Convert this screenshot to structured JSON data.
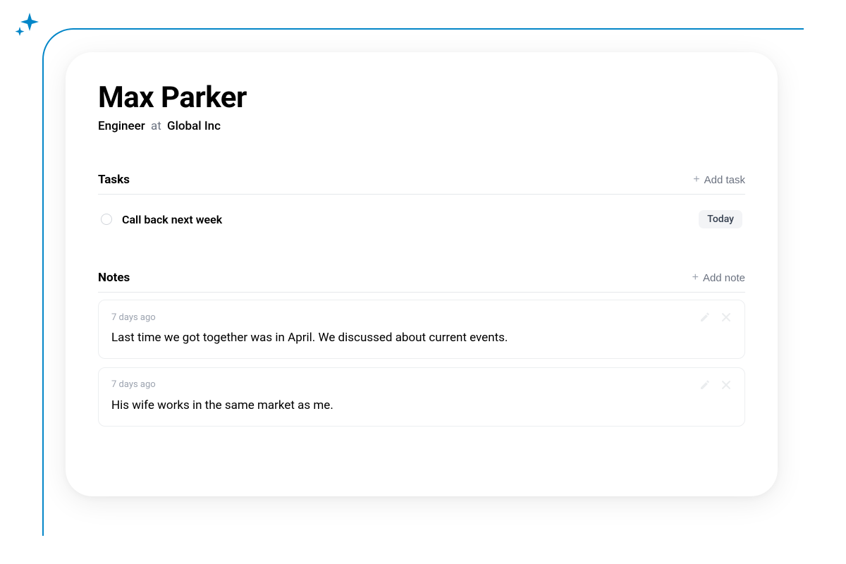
{
  "colors": {
    "accent_blue": "#0386c8"
  },
  "contact": {
    "name": "Max Parker",
    "role": "Engineer",
    "separator": "at",
    "company": "Global Inc"
  },
  "tasks": {
    "heading": "Tasks",
    "add_label": "Add task",
    "items": [
      {
        "text": "Call back next week",
        "due": "Today"
      }
    ]
  },
  "notes": {
    "heading": "Notes",
    "add_label": "Add note",
    "items": [
      {
        "time": "7 days ago",
        "body": "Last time we got together was in April. We discussed about current events."
      },
      {
        "time": "7 days ago",
        "body": "His wife works in the same market as me."
      }
    ]
  }
}
